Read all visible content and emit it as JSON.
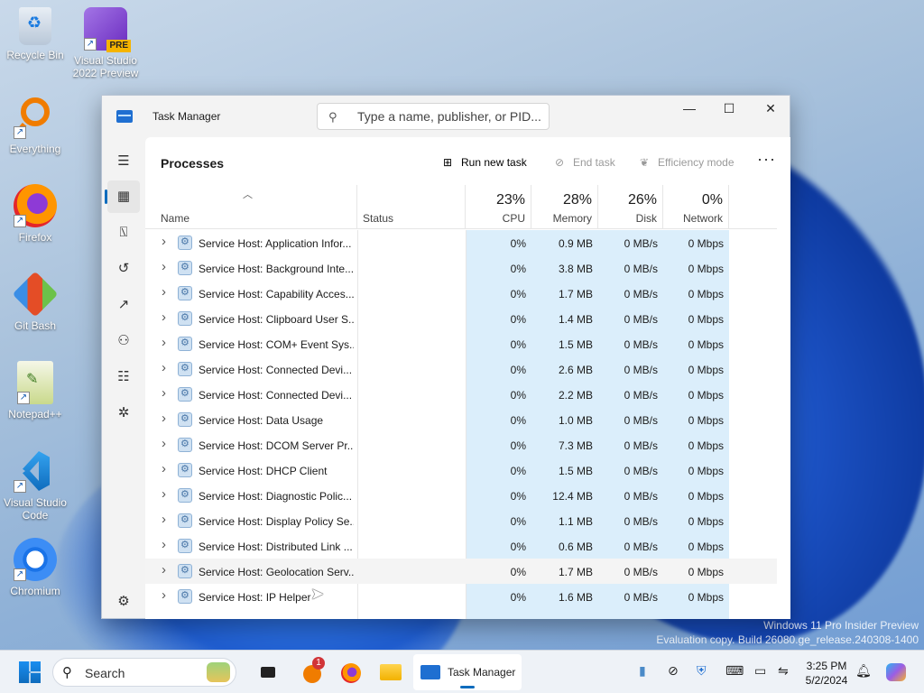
{
  "desktop": {
    "icons": [
      {
        "label": "Recycle Bin",
        "icon": "recycle-bin-icon"
      },
      {
        "label": "Visual Studio 2022 Preview",
        "icon": "visual-studio-icon",
        "badge": "PRE"
      },
      {
        "label": "Everything",
        "icon": "everything-search-icon"
      },
      {
        "label": "Firefox",
        "icon": "firefox-icon"
      },
      {
        "label": "Git Bash",
        "icon": "git-bash-icon"
      },
      {
        "label": "Notepad++",
        "icon": "notepad-plus-plus-icon"
      },
      {
        "label": "Visual Studio Code",
        "icon": "vscode-icon"
      },
      {
        "label": "Chromium",
        "icon": "chromium-icon"
      }
    ],
    "watermark": {
      "line1": "Windows 11 Pro Insider Preview",
      "line2": "Evaluation copy. Build 26080.ge_release.240308-1400"
    }
  },
  "window": {
    "title": "Task Manager",
    "search_placeholder": "Type a name, publisher, or PID...",
    "controls": {
      "minimize": "—",
      "maximize": "☐",
      "close": "✕"
    },
    "nav": [
      {
        "name": "menu",
        "icon": "hamburger-menu-icon",
        "glyph": "☰"
      },
      {
        "name": "processes",
        "icon": "processes-icon",
        "glyph": "▦",
        "active": true
      },
      {
        "name": "performance",
        "icon": "performance-icon",
        "glyph": "⍂"
      },
      {
        "name": "app-history",
        "icon": "history-icon",
        "glyph": "↺"
      },
      {
        "name": "startup-apps",
        "icon": "startup-icon",
        "glyph": "↗"
      },
      {
        "name": "users",
        "icon": "users-icon",
        "glyph": "⚇"
      },
      {
        "name": "details",
        "icon": "details-list-icon",
        "glyph": "☷"
      },
      {
        "name": "services",
        "icon": "services-icon",
        "glyph": "✲"
      },
      {
        "name": "settings",
        "icon": "settings-gear-icon",
        "glyph": "⚙"
      }
    ],
    "page_title": "Processes",
    "commands": {
      "run_new_task": "Run new task",
      "end_task": "End task",
      "efficiency_mode": "Efficiency mode",
      "more": "···"
    },
    "columns": {
      "name": "Name",
      "status": "Status",
      "cpu": {
        "pct": "23%",
        "label": "CPU"
      },
      "memory": {
        "pct": "28%",
        "label": "Memory"
      },
      "disk": {
        "pct": "26%",
        "label": "Disk"
      },
      "network": {
        "pct": "0%",
        "label": "Network"
      }
    },
    "processes": [
      {
        "name": "Service Host: Application Infor...",
        "cpu": "0%",
        "memory": "0.9 MB",
        "disk": "0 MB/s",
        "network": "0 Mbps"
      },
      {
        "name": "Service Host: Background Inte...",
        "cpu": "0%",
        "memory": "3.8 MB",
        "disk": "0 MB/s",
        "network": "0 Mbps"
      },
      {
        "name": "Service Host: Capability Acces...",
        "cpu": "0%",
        "memory": "1.7 MB",
        "disk": "0 MB/s",
        "network": "0 Mbps"
      },
      {
        "name": "Service Host: Clipboard User S...",
        "cpu": "0%",
        "memory": "1.4 MB",
        "disk": "0 MB/s",
        "network": "0 Mbps"
      },
      {
        "name": "Service Host: COM+ Event Sys...",
        "cpu": "0%",
        "memory": "1.5 MB",
        "disk": "0 MB/s",
        "network": "0 Mbps"
      },
      {
        "name": "Service Host: Connected Devi...",
        "cpu": "0%",
        "memory": "2.6 MB",
        "disk": "0 MB/s",
        "network": "0 Mbps"
      },
      {
        "name": "Service Host: Connected Devi...",
        "cpu": "0%",
        "memory": "2.2 MB",
        "disk": "0 MB/s",
        "network": "0 Mbps"
      },
      {
        "name": "Service Host: Data Usage",
        "cpu": "0%",
        "memory": "1.0 MB",
        "disk": "0 MB/s",
        "network": "0 Mbps"
      },
      {
        "name": "Service Host: DCOM Server Pr...",
        "cpu": "0%",
        "memory": "7.3 MB",
        "disk": "0 MB/s",
        "network": "0 Mbps"
      },
      {
        "name": "Service Host: DHCP Client",
        "cpu": "0%",
        "memory": "1.5 MB",
        "disk": "0 MB/s",
        "network": "0 Mbps"
      },
      {
        "name": "Service Host: Diagnostic Polic...",
        "cpu": "0%",
        "memory": "12.4 MB",
        "disk": "0 MB/s",
        "network": "0 Mbps"
      },
      {
        "name": "Service Host: Display Policy Se...",
        "cpu": "0%",
        "memory": "1.1 MB",
        "disk": "0 MB/s",
        "network": "0 Mbps"
      },
      {
        "name": "Service Host: Distributed Link ...",
        "cpu": "0%",
        "memory": "0.6 MB",
        "disk": "0 MB/s",
        "network": "0 Mbps"
      },
      {
        "name": "Service Host: Geolocation Serv...",
        "cpu": "0%",
        "memory": "1.7 MB",
        "disk": "0 MB/s",
        "network": "0 Mbps",
        "hover": true
      },
      {
        "name": "Service Host: IP Helper",
        "cpu": "0%",
        "memory": "1.6 MB",
        "disk": "0 MB/s",
        "network": "0 Mbps"
      }
    ]
  },
  "taskbar": {
    "search_label": "Search",
    "active_app": "Task Manager",
    "notification_badge": "1",
    "clock": {
      "time": "3:25 PM",
      "date": "5/2/2024"
    }
  },
  "colors": {
    "accent": "#0f6cbd",
    "data_column_bg": "#dbeefb"
  }
}
